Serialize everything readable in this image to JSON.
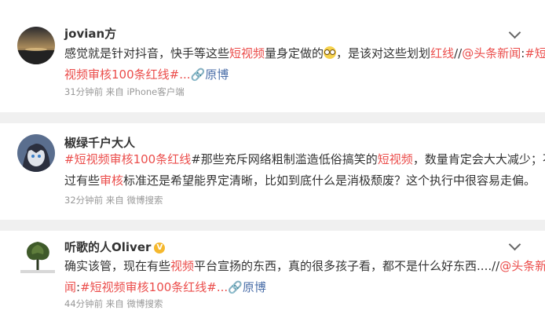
{
  "posts": [
    {
      "username": "jovian方",
      "lines": [
        [
          {
            "t": "感觉就是针对抖音，快手等这些",
            "c": ""
          },
          {
            "t": "短视频",
            "c": "hl"
          },
          {
            "t": "量身定做的",
            "c": ""
          },
          {
            "t": "[emoji]",
            "c": "emoji"
          },
          {
            "t": "，是该对这些划划",
            "c": ""
          },
          {
            "t": "红线",
            "c": "hl"
          },
          {
            "t": "//",
            "c": ""
          },
          {
            "t": "@头条新闻",
            "c": "link"
          },
          {
            "t": ":",
            "c": ""
          },
          {
            "t": "#短",
            "c": "link"
          }
        ],
        [
          {
            "t": "视频审核100条红线#...",
            "c": "link"
          },
          {
            "t": "🔗原博",
            "c": "src"
          }
        ]
      ],
      "meta": "31分钟前 来自 iPhone客户端"
    },
    {
      "username": "椒绿千户大人",
      "lines": [
        [
          {
            "t": "#",
            "c": "link"
          },
          {
            "t": "短视频审核100条红线",
            "c": "link"
          },
          {
            "t": "#那些充斥网络粗制滥造低俗搞笑的",
            "c": ""
          },
          {
            "t": "短视频",
            "c": "hl"
          },
          {
            "t": "，数量肯定会大大减少；不",
            "c": ""
          }
        ],
        [
          {
            "t": "过有些",
            "c": ""
          },
          {
            "t": "审核",
            "c": "hl"
          },
          {
            "t": "标准还是希望能界定清晰，比如到底什么是消极颓废？这个执行中很容易走偏。",
            "c": ""
          }
        ]
      ],
      "meta": "32分钟前 来自 微博搜索"
    },
    {
      "username": "听歌的人Oliver",
      "verified_badge": "V",
      "lines": [
        [
          {
            "t": "确实该管，现在有些",
            "c": ""
          },
          {
            "t": "视频",
            "c": "hl"
          },
          {
            "t": "平台宣扬的东西，真的很多孩子看，都不是什么好东西....//",
            "c": ""
          },
          {
            "t": "@头条新",
            "c": "link"
          }
        ],
        [
          {
            "t": "闻",
            "c": "link"
          },
          {
            "t": ":",
            "c": ""
          },
          {
            "t": "#短视频审核100条红线#...",
            "c": "link"
          },
          {
            "t": "🔗原博",
            "c": "src"
          }
        ]
      ],
      "meta": "44分钟前 来自 微博搜索"
    }
  ]
}
